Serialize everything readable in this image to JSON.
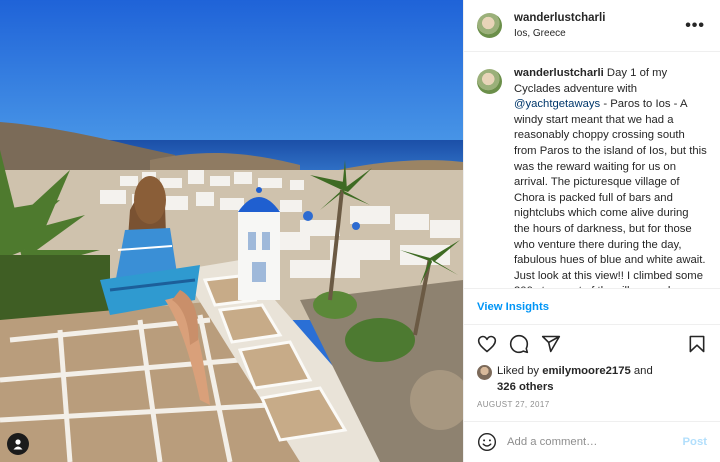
{
  "post": {
    "username": "wanderlustcharli",
    "location": "Ios, Greece",
    "more_label": "•••"
  },
  "caption": {
    "username": "wanderlustcharli",
    "text_before": " Day 1 of my Cyclades adventure with ",
    "mention": "@yachtgetaways",
    "text_after": " - Paros to Ios - A windy start meant that we had a reasonably choppy crossing south from Paros to the island of Ios, but this was the reward waiting for us on arrival. The picturesque village of Chora is packed full of bars and nightclubs which come alive during the hours of darkness, but for those who venture there during the day, fabulous hues of blue and white await. Just look at this view!! I climbed some 300 steps out of the village and up a hill to a point where four churches (two with the"
  },
  "insights": {
    "label": "View Insights"
  },
  "actions": {
    "icons": [
      "heart-icon",
      "comment-icon",
      "share-icon",
      "bookmark-icon"
    ]
  },
  "likes": {
    "prefix": "Liked by ",
    "user": "emilymoore2175",
    "middle": " and",
    "others": "326 others"
  },
  "date": "AUGUST 27, 2017",
  "comment": {
    "placeholder": "Add a comment…",
    "post_label": "Post"
  },
  "colors": {
    "link_blue": "#0095f6",
    "mention_blue": "#00376b",
    "post_disabled": "#b2dffc",
    "muted": "#8e8e8e"
  }
}
